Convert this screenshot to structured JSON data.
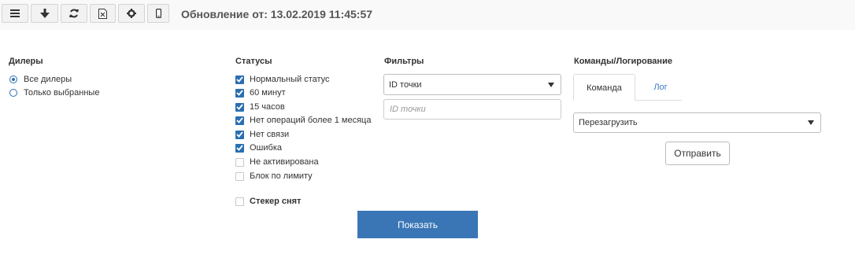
{
  "toolbar": {
    "buttons": [
      {
        "icon": "menu-icon"
      },
      {
        "icon": "arrow-down-icon"
      },
      {
        "icon": "refresh-icon"
      },
      {
        "icon": "excel-icon"
      },
      {
        "icon": "gear-icon"
      },
      {
        "icon": "mobile-icon"
      }
    ],
    "update_label": "Обновление от: 13.02.2019 11:45:57"
  },
  "dealers": {
    "title": "Дилеры",
    "options": [
      {
        "label": "Все дилеры",
        "selected": true
      },
      {
        "label": "Только выбранные",
        "selected": false
      }
    ]
  },
  "statuses": {
    "title": "Статусы",
    "items": [
      {
        "label": "Нормальный статус",
        "checked": true
      },
      {
        "label": "60 минут",
        "checked": true
      },
      {
        "label": "15 часов",
        "checked": true
      },
      {
        "label": "Нет операций более 1 месяца",
        "checked": true
      },
      {
        "label": "Нет связи",
        "checked": true
      },
      {
        "label": "Ошибка",
        "checked": true
      },
      {
        "label": "Не активирована",
        "checked": false
      },
      {
        "label": "Блок по лимиту",
        "checked": false
      }
    ],
    "sticker": {
      "label": "Стекер снят",
      "checked": false
    }
  },
  "filters": {
    "title": "Фильтры",
    "select_value": "ID точки",
    "input_placeholder": "ID точки"
  },
  "commands": {
    "title": "Команды/Логирование",
    "tabs": [
      {
        "label": "Команда",
        "active": true
      },
      {
        "label": "Лог",
        "active": false
      }
    ],
    "select_value": "Перезагрузить",
    "send_label": "Отправить"
  },
  "show_label": "Показать",
  "colors": {
    "accent": "#3a76b6",
    "checkbox": "#2a6fb0",
    "link": "#3a7bc8"
  }
}
